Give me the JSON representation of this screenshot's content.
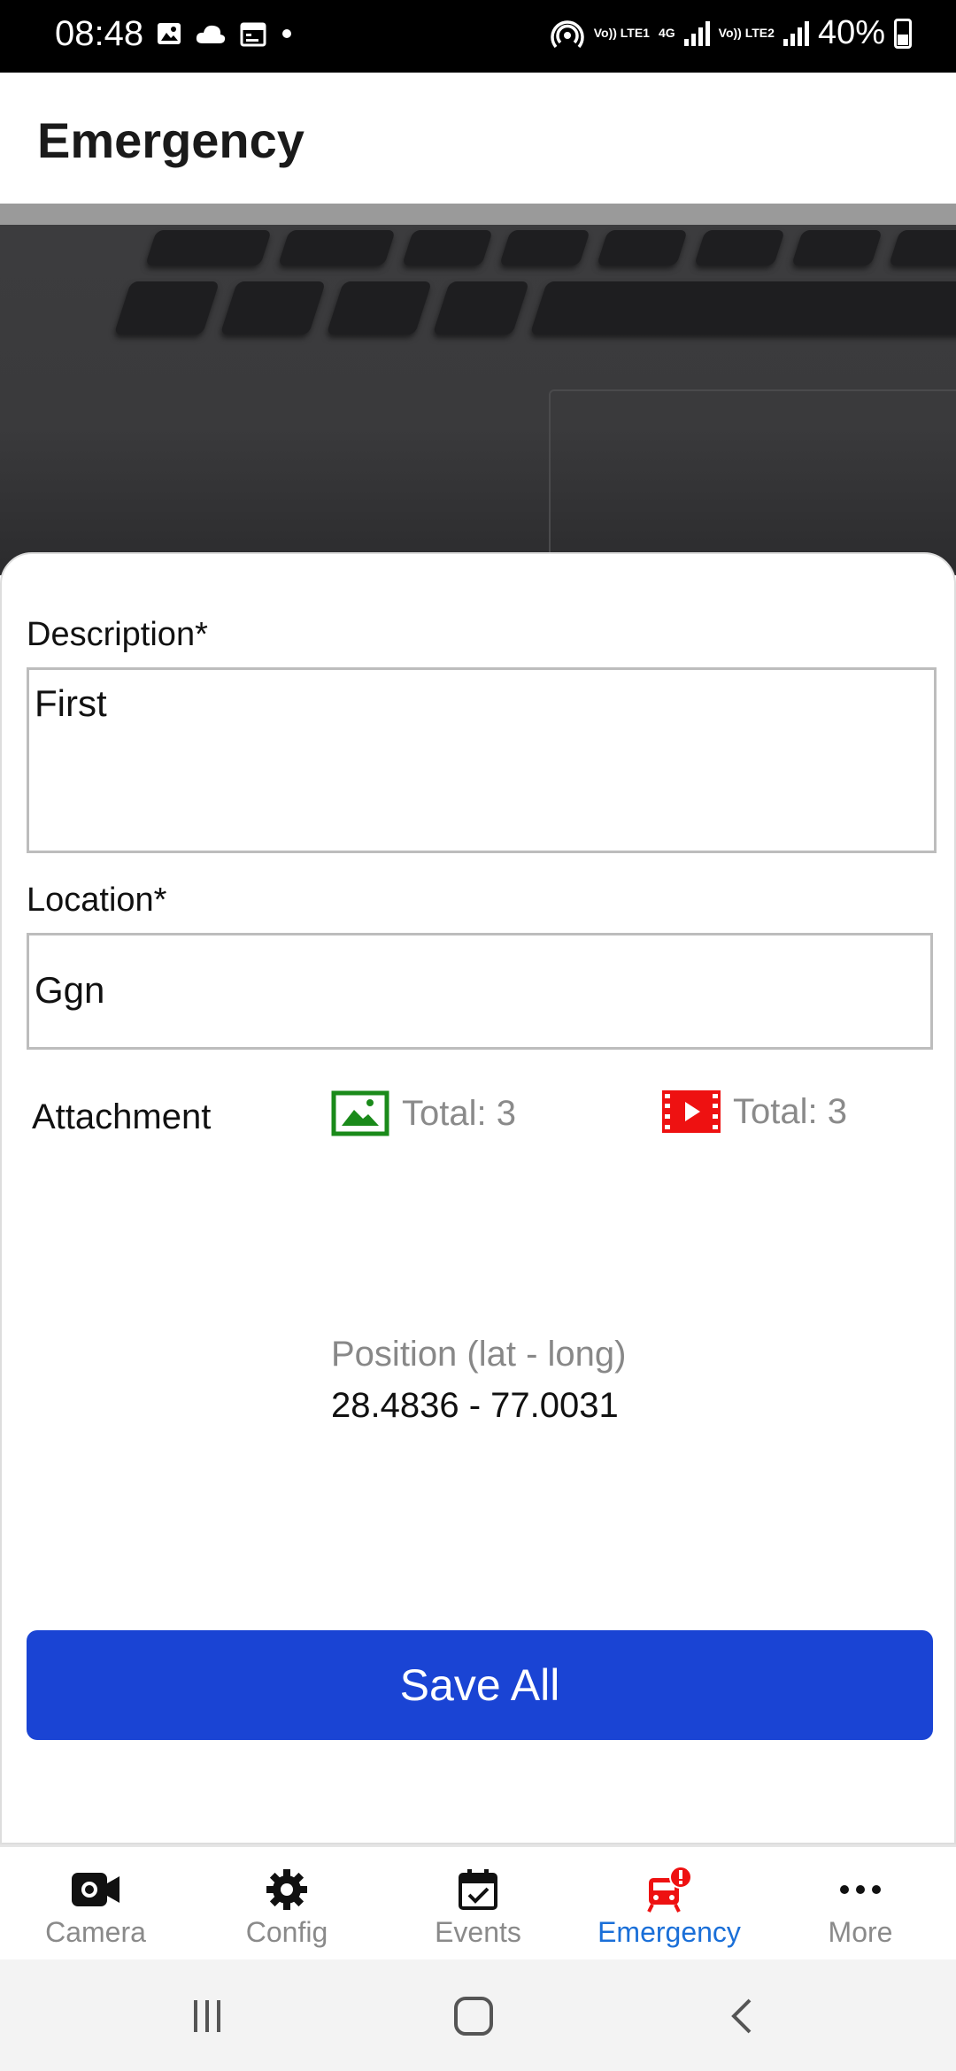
{
  "status_bar": {
    "time": "08:48",
    "battery": "40%",
    "sim1_tag": "Vo)) LTE1",
    "sim2_tag": "Vo)) LTE2",
    "net_tag": "4G",
    "icons": [
      "gallery-icon",
      "cloud-icon",
      "calendar-icon",
      "dot-icon",
      "hotspot-icon",
      "signal-icon",
      "battery-icon"
    ]
  },
  "header": {
    "title": "Emergency"
  },
  "form": {
    "description_label": "Description*",
    "description_value": "First",
    "location_label": "Location*",
    "location_value": "Ggn",
    "attachment_label": "Attachment",
    "image_total": "Total: 3",
    "video_total": "Total: 3",
    "image_icon_color": "#1a8a1a",
    "video_icon_color": "#ee1111",
    "position_label": "Position (lat - long)",
    "position_value": "28.4836 - 77.0031",
    "save_label": "Save All"
  },
  "bottom_nav": {
    "items": [
      {
        "label": "Camera",
        "icon": "camera-icon"
      },
      {
        "label": "Config",
        "icon": "gear-icon"
      },
      {
        "label": "Events",
        "icon": "calendar-check-icon"
      },
      {
        "label": "Emergency",
        "icon": "emergency-icon",
        "active": true
      },
      {
        "label": "More",
        "icon": "more-icon"
      }
    ],
    "active_color": "#1a6fd8"
  }
}
